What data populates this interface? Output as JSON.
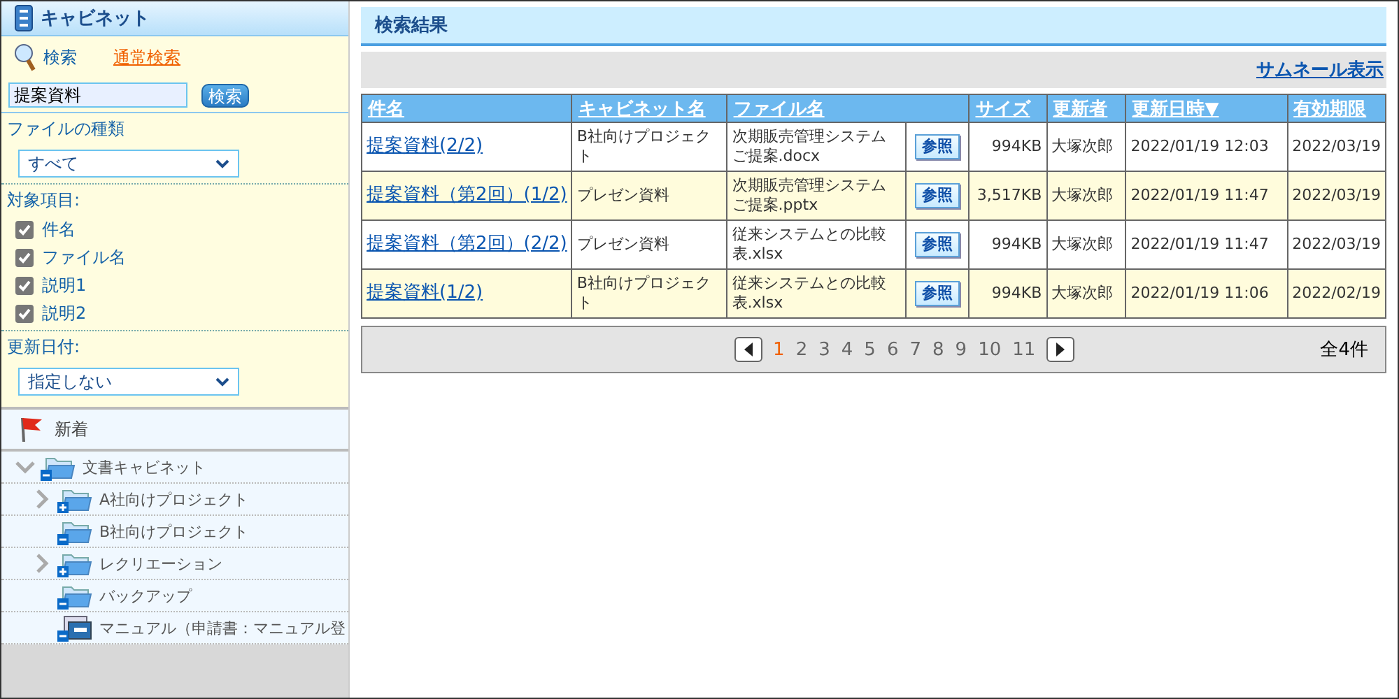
{
  "sidebar": {
    "title": "キャビネット",
    "search": {
      "label": "検索",
      "mode_link": "通常検索",
      "value": "提案資料",
      "button": "検索"
    },
    "file_type": {
      "label": "ファイルの種類",
      "value": "すべて"
    },
    "targets": {
      "label": "対象項目:",
      "items": [
        {
          "label": "件名",
          "checked": true
        },
        {
          "label": "ファイル名",
          "checked": true
        },
        {
          "label": "説明1",
          "checked": true
        },
        {
          "label": "説明2",
          "checked": true
        }
      ]
    },
    "updated": {
      "label": "更新日付:",
      "value": "指定しない"
    },
    "new_item": "新着",
    "tree": [
      {
        "label": "文書キャビネット",
        "kind": "folder",
        "expanded": true,
        "children": [
          {
            "label": "A社向けプロジェクト",
            "kind": "folder",
            "expanded": false,
            "expandable": true
          },
          {
            "label": "B社向けプロジェクト",
            "kind": "folder",
            "expanded": false,
            "expandable": false
          },
          {
            "label": "レクリエーション",
            "kind": "folder",
            "expanded": false,
            "expandable": true
          },
          {
            "label": "バックアップ",
            "kind": "folder",
            "expanded": false,
            "expandable": false
          },
          {
            "label": "マニュアル（申請書：マニュアル登",
            "kind": "linked",
            "expanded": false,
            "expandable": false
          }
        ]
      }
    ]
  },
  "results": {
    "title": "検索結果",
    "thumbnail_link": "サムネール表示",
    "table": {
      "columns": [
        "件名",
        "キャビネット名",
        "ファイル名",
        "サイズ",
        "更新者",
        "更新日時▼",
        "有効期限"
      ],
      "rows": [
        {
          "subject": "提案資料(2/2)",
          "cabinet": "B社向けプロジェクト",
          "file": "次期販売管理システムご提案.docx",
          "button": "参照",
          "size": "994KB",
          "updater": "大塚次郎",
          "updated": "2022/01/19 12:03",
          "expires": "2022/03/19"
        },
        {
          "subject": "提案資料（第2回）(1/2)",
          "cabinet": "プレゼン資料",
          "file": "次期販売管理システムご提案.pptx",
          "button": "参照",
          "size": "3,517KB",
          "updater": "大塚次郎",
          "updated": "2022/01/19 11:47",
          "expires": "2022/03/19"
        },
        {
          "subject": "提案資料（第2回）(2/2)",
          "cabinet": "プレゼン資料",
          "file": "従来システムとの比較表.xlsx",
          "button": "参照",
          "size": "994KB",
          "updater": "大塚次郎",
          "updated": "2022/01/19 11:47",
          "expires": "2022/03/19"
        },
        {
          "subject": "提案資料(1/2)",
          "cabinet": "B社向けプロジェクト",
          "file": "従来システムとの比較表.xlsx",
          "button": "参照",
          "size": "994KB",
          "updater": "大塚次郎",
          "updated": "2022/01/19 11:06",
          "expires": "2022/02/19"
        }
      ]
    },
    "pagination": {
      "pages": [
        {
          "label": "1",
          "selected": true
        },
        {
          "label": "2",
          "selected": false
        },
        {
          "label": "3",
          "selected": false
        },
        {
          "label": "4",
          "selected": false
        },
        {
          "label": "5",
          "selected": false
        },
        {
          "label": "6",
          "selected": false
        },
        {
          "label": "7",
          "selected": false
        },
        {
          "label": "8",
          "selected": false
        },
        {
          "label": "9",
          "selected": false
        },
        {
          "label": "10",
          "selected": false
        },
        {
          "label": "11",
          "selected": false
        }
      ],
      "total": "全4件"
    }
  }
}
